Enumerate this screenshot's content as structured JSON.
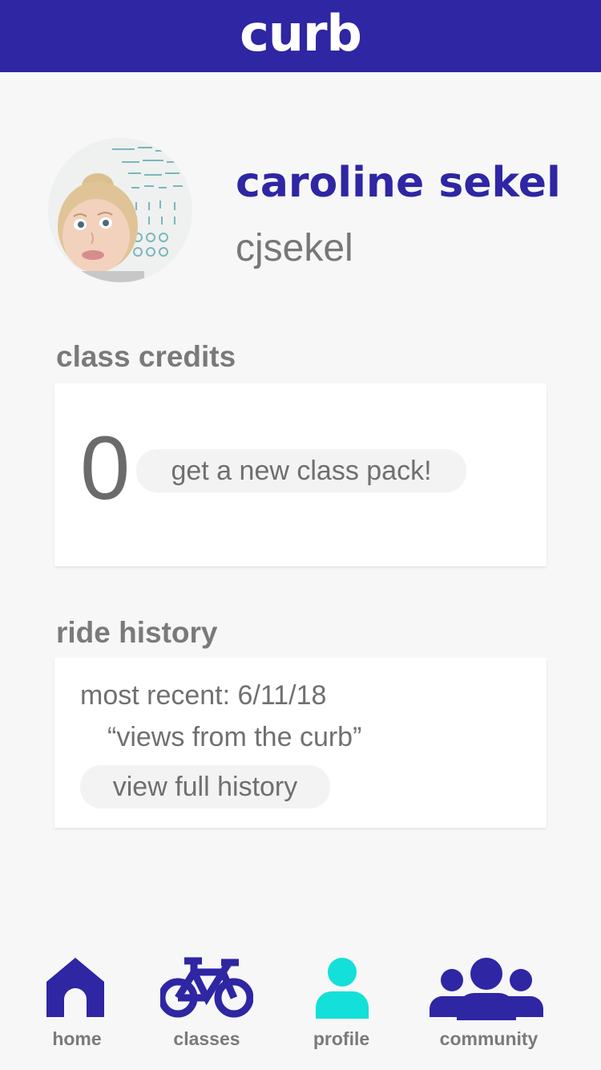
{
  "header": {
    "logo": "curb"
  },
  "profile": {
    "name": "caroline sekel",
    "handle": "cjsekel"
  },
  "credits": {
    "title": "class credits",
    "count": "0",
    "button_label": "get a new class pack!"
  },
  "history": {
    "title": "ride history",
    "most_recent": "most recent: 6/11/18",
    "recent_class": "“views from the curb”",
    "button_label": "view full history"
  },
  "nav": {
    "items": [
      {
        "label": "home",
        "icon": "home-icon"
      },
      {
        "label": "classes",
        "icon": "bike-icon"
      },
      {
        "label": "profile",
        "icon": "person-icon",
        "active": true
      },
      {
        "label": "community",
        "icon": "group-icon"
      }
    ]
  },
  "colors": {
    "brand": "#2e26a3",
    "active": "#13e0d8",
    "text_muted": "#7a7a7a",
    "background": "#f7f7f7"
  }
}
